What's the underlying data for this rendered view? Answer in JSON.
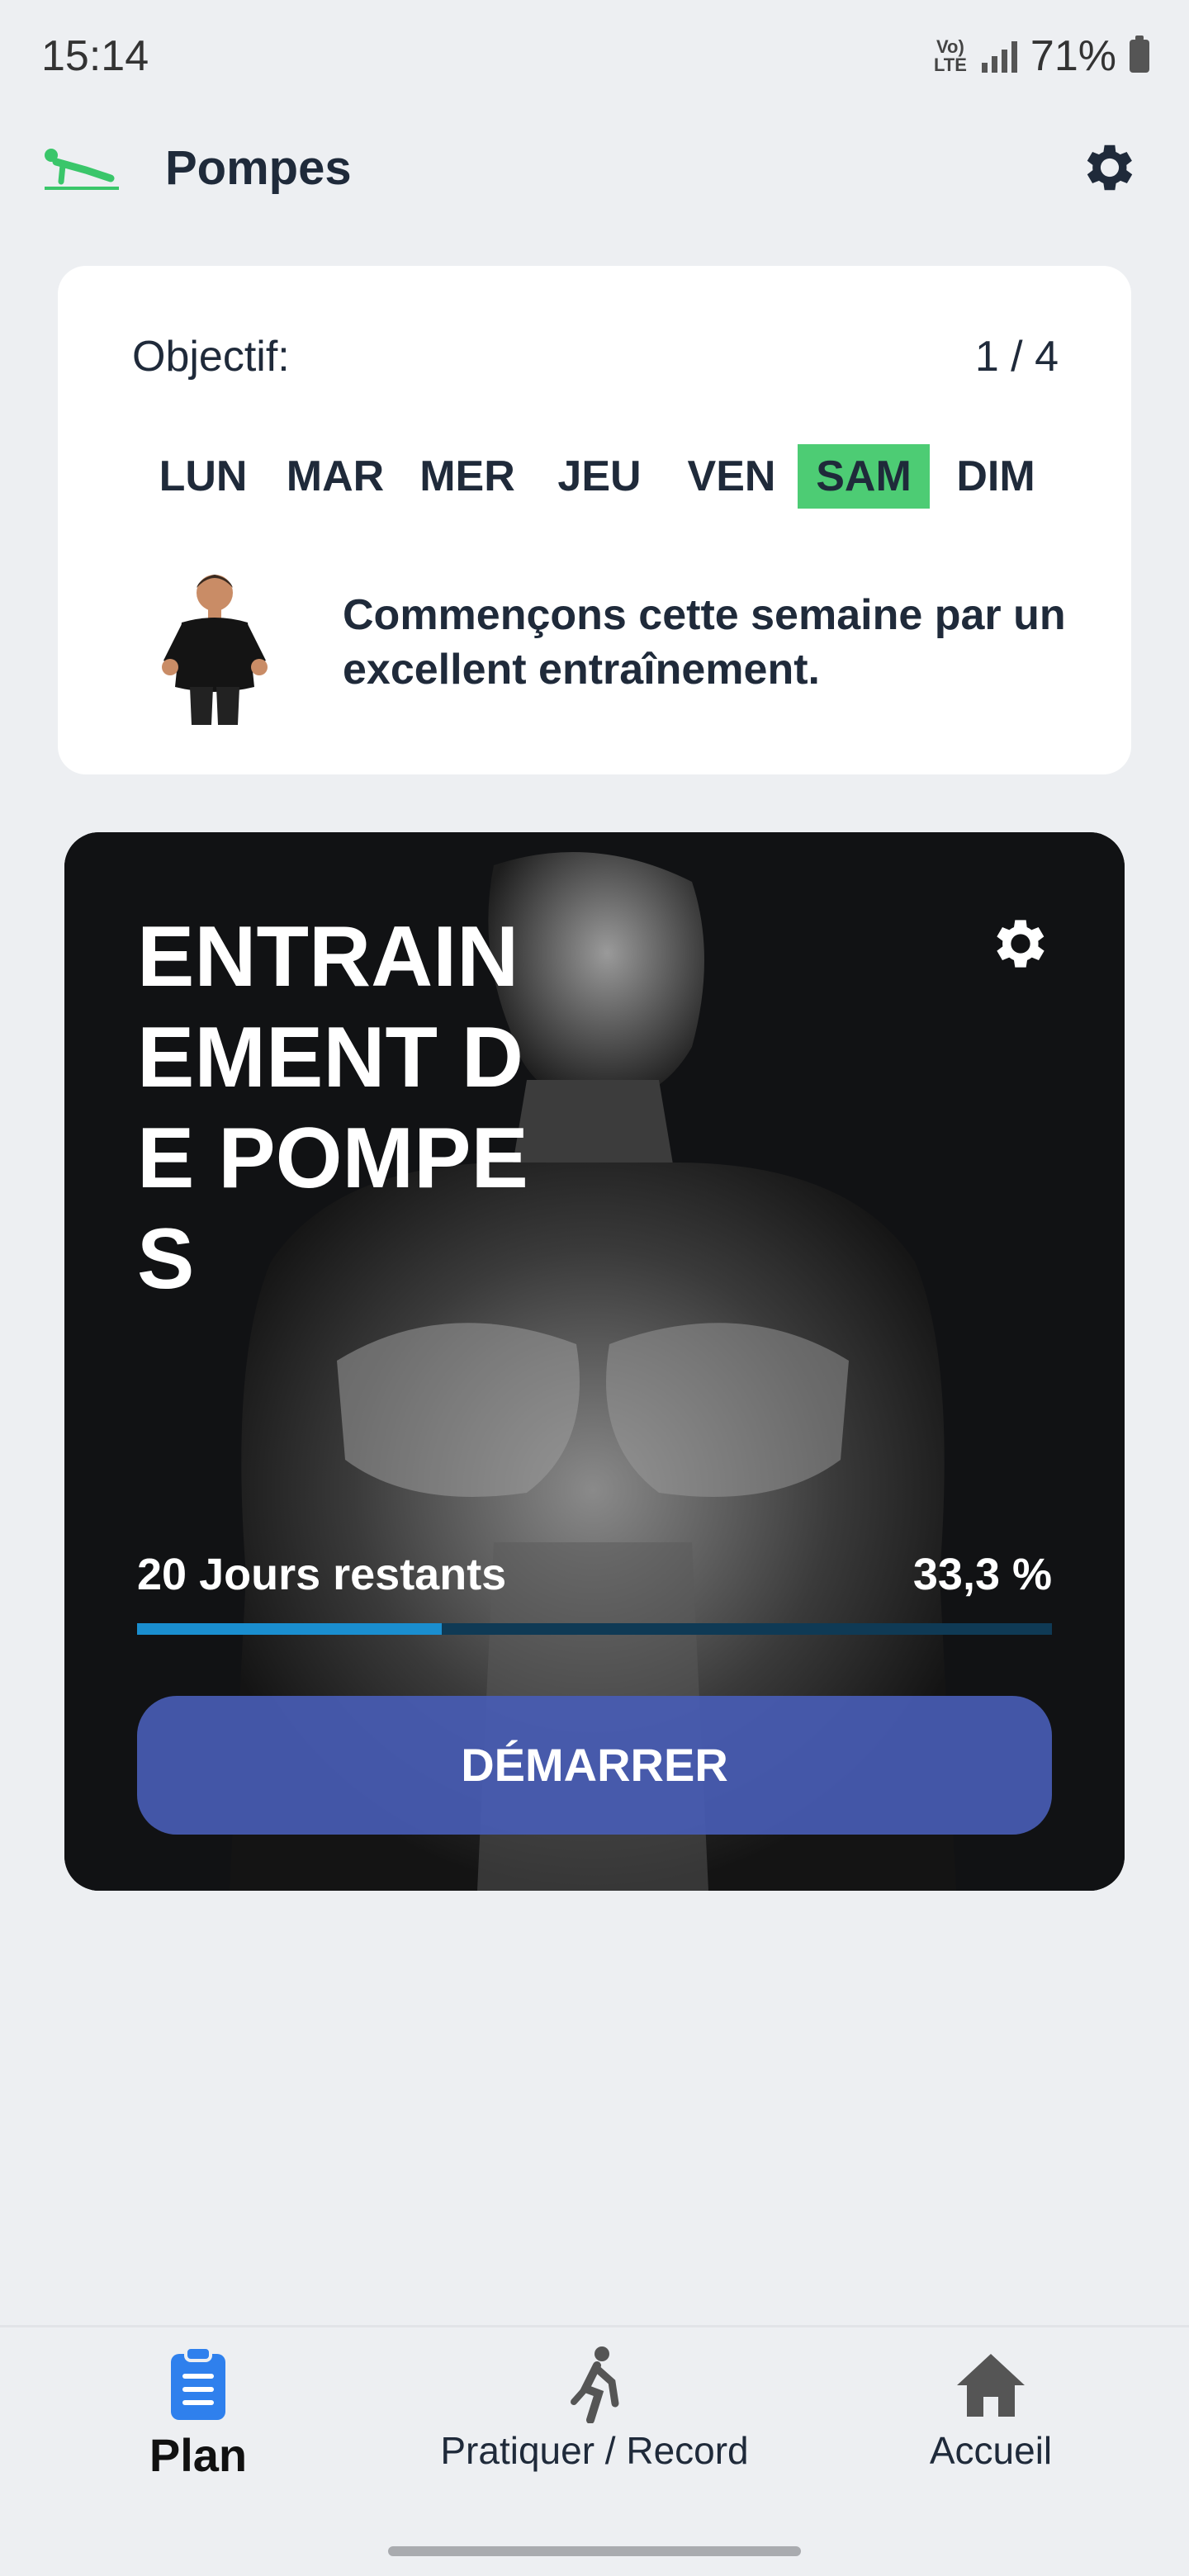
{
  "status_bar": {
    "time": "15:14",
    "network": "Vo) LTE",
    "battery": "71%"
  },
  "header": {
    "title": "Pompes",
    "icon": "pushup-icon",
    "settings_icon": "gear-icon"
  },
  "goal": {
    "label": "Objectif:",
    "count": "1 / 4",
    "days": [
      {
        "label": "LUN",
        "active": false
      },
      {
        "label": "MAR",
        "active": false
      },
      {
        "label": "MER",
        "active": false
      },
      {
        "label": "JEU",
        "active": false
      },
      {
        "label": "VEN",
        "active": false
      },
      {
        "label": "SAM",
        "active": true
      },
      {
        "label": "DIM",
        "active": false
      }
    ],
    "message": "Commençons cette semaine par un excellent entraînement.",
    "active_color": "#4dcc74"
  },
  "workout": {
    "title": "ENTRAINEMENT DE POMPES",
    "days_remaining": "20 Jours restants",
    "progress_text": "33,3 %",
    "progress_fraction": 0.333,
    "start_label": "DÉMARRER",
    "button_color": "#485cb4",
    "progress_color": "#1a8ecf"
  },
  "bottom_nav": {
    "items": [
      {
        "label": "Plan",
        "icon": "clipboard-icon",
        "active": true
      },
      {
        "label": "Pratiquer / Record",
        "icon": "exercise-icon",
        "active": false
      },
      {
        "label": "Accueil",
        "icon": "home-icon",
        "active": false
      }
    ],
    "active_color": "#2f80ed"
  }
}
